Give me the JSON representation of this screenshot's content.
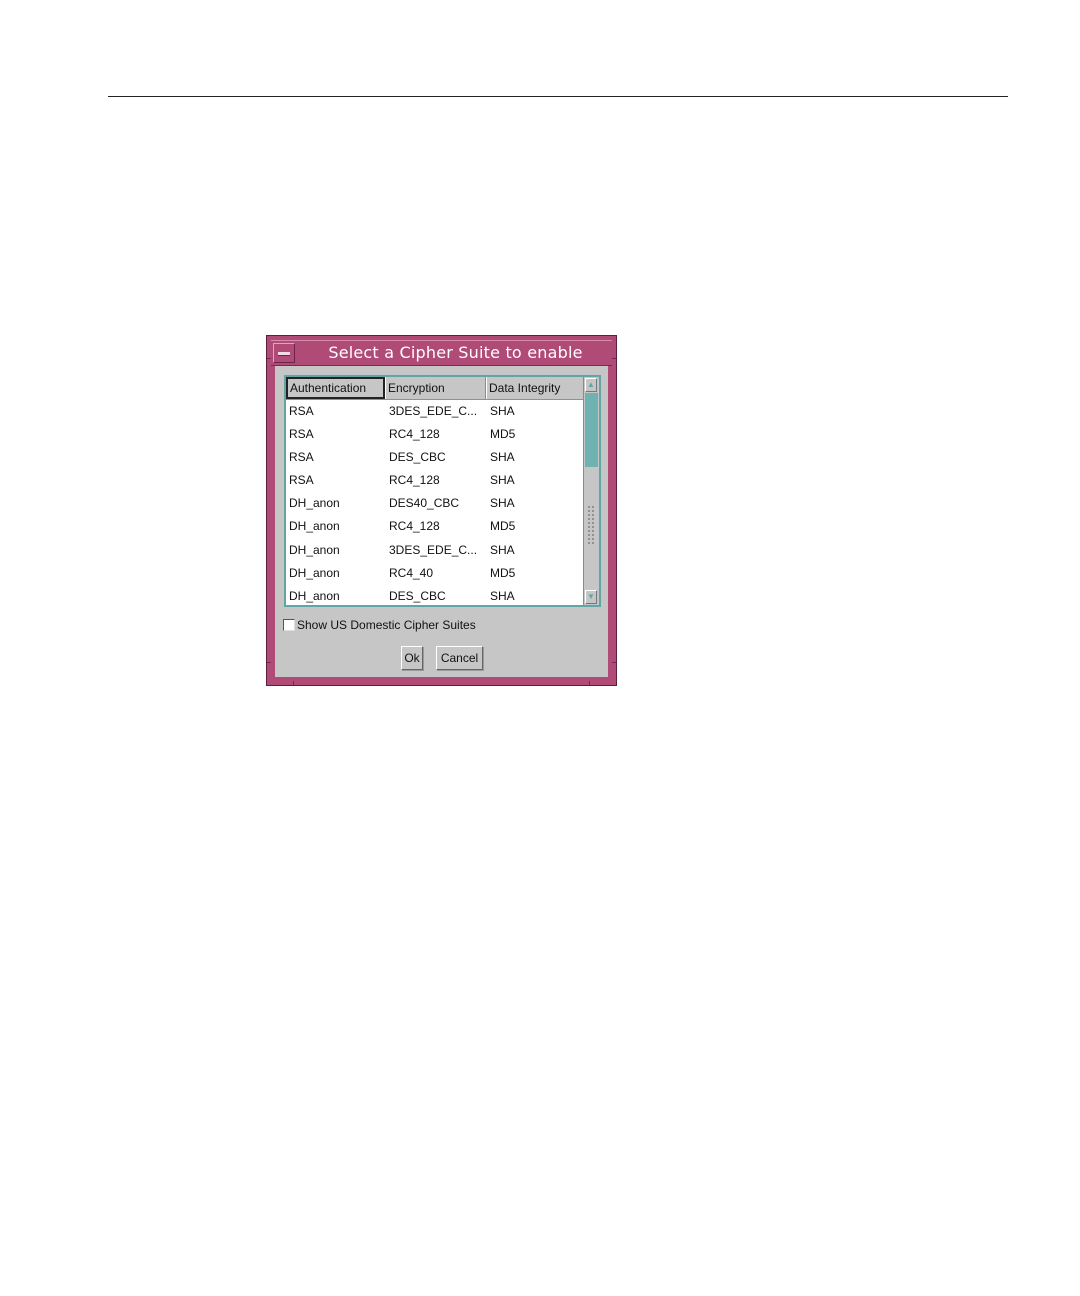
{
  "dialog": {
    "title": "Select a Cipher Suite to enable",
    "menu_icon": "window-menu-icon",
    "frame_color": "#b04a77",
    "accent_color": "#5fa6a6",
    "table": {
      "columns": [
        "Authentication",
        "Encryption",
        "Data Integrity"
      ],
      "rows": [
        [
          "RSA",
          "3DES_EDE_C...",
          "SHA"
        ],
        [
          "RSA",
          "RC4_128",
          "MD5"
        ],
        [
          "RSA",
          "DES_CBC",
          "SHA"
        ],
        [
          "RSA",
          "RC4_128",
          "SHA"
        ],
        [
          "DH_anon",
          "DES40_CBC",
          "SHA"
        ],
        [
          "DH_anon",
          "RC4_128",
          "MD5"
        ],
        [
          "DH_anon",
          "3DES_EDE_C...",
          "SHA"
        ],
        [
          "DH_anon",
          "RC4_40",
          "MD5"
        ],
        [
          "DH_anon",
          "DES_CBC",
          "SHA"
        ]
      ]
    },
    "checkbox": {
      "label": "Show US Domestic Cipher Suites",
      "checked": false
    },
    "buttons": {
      "ok_label": "Ok",
      "cancel_label": "Cancel"
    },
    "scrollbar": {
      "up_icon": "▲",
      "down_icon": "▼"
    }
  }
}
